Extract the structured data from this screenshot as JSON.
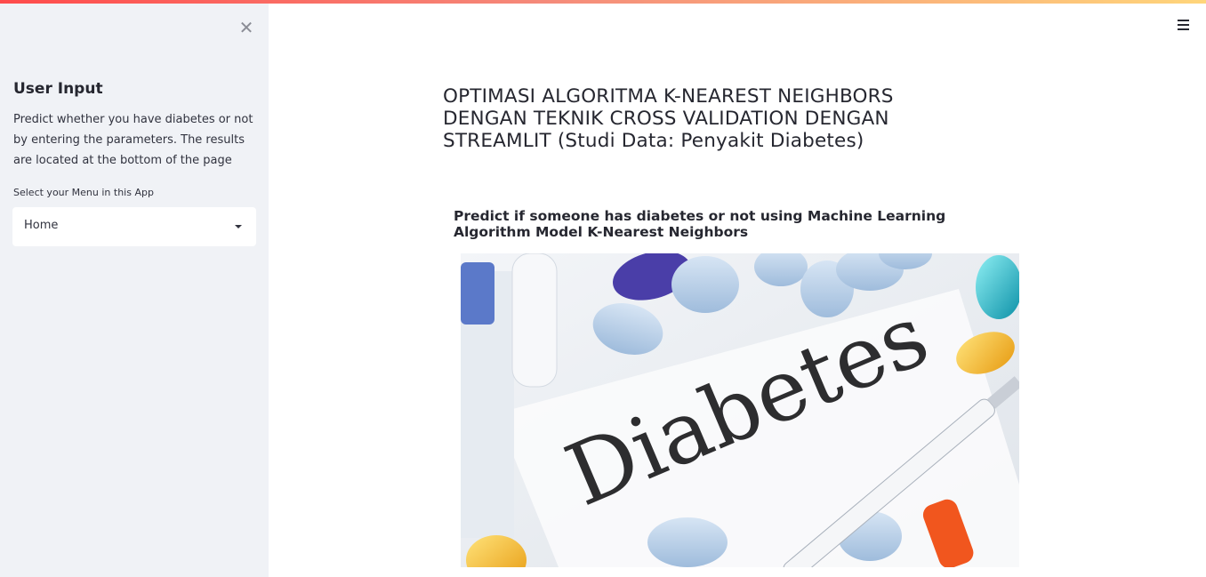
{
  "sidebar": {
    "close_icon": "close-icon",
    "title": "User Input",
    "description": "Predict whether you have diabetes or not by entering the parameters. The results are located at the bottom of the page",
    "select_label": "Select your Menu in this App",
    "select_value": "Home"
  },
  "header": {
    "menu_icon": "hamburger-menu-icon"
  },
  "main": {
    "title": "OPTIMASI ALGORITMA K-NEAREST NEIGHBORS DENGAN TEKNIK CROSS VALIDATION DENGAN STREAMLIT (Studi Data: Penyakit Diabetes)",
    "subheading": "Predict if someone has diabetes or not using Machine Learning Algorithm Model K-Nearest Neighbors",
    "image_text": "Diabetes"
  },
  "colors": {
    "accent_gradient_start": "#ff4b4b",
    "accent_gradient_end": "#ffd57a",
    "sidebar_bg": "#f0f2f6",
    "text": "#262730"
  }
}
